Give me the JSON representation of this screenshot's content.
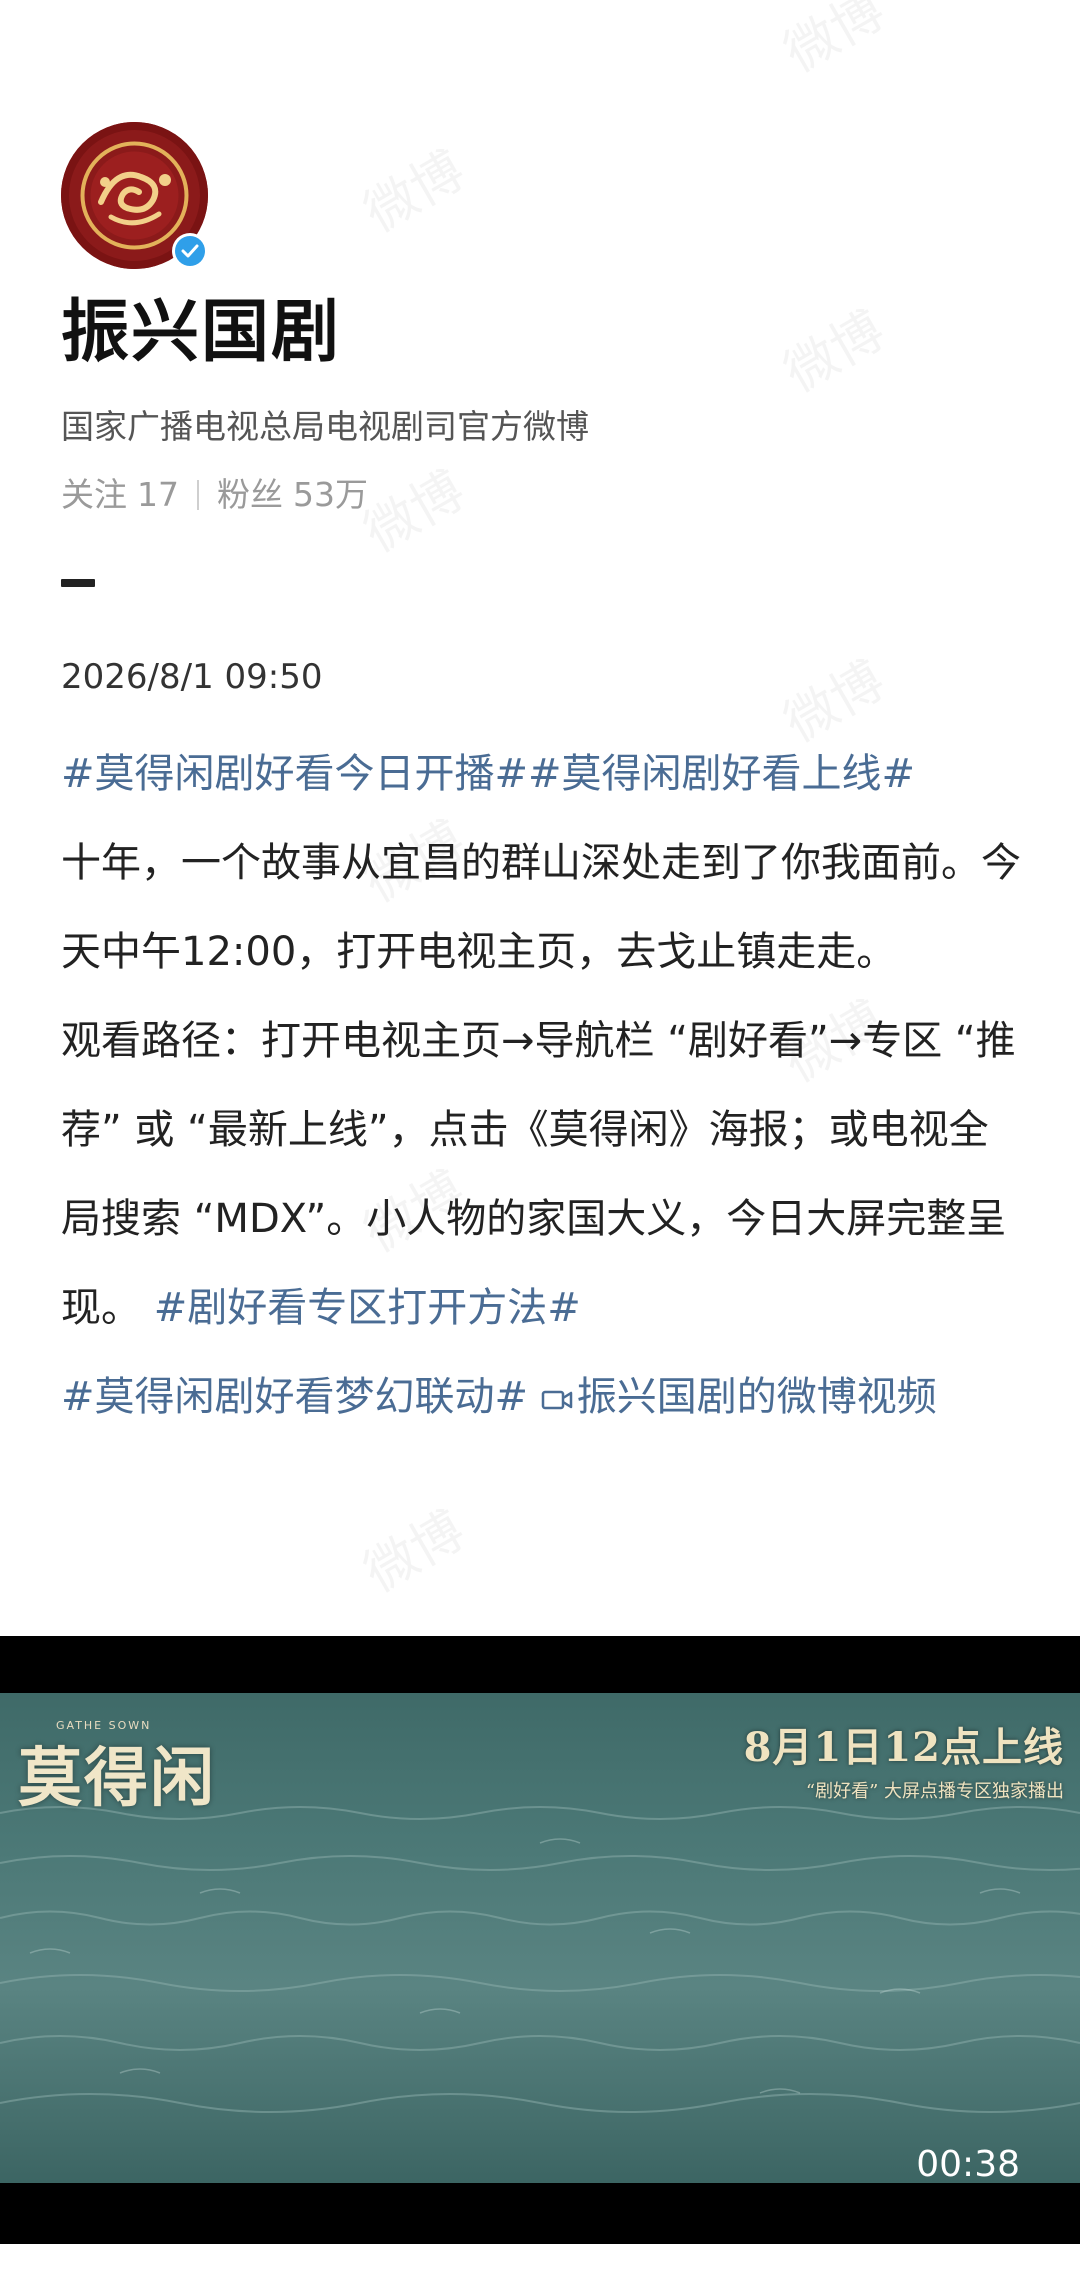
{
  "profile": {
    "name": "振兴国剧",
    "description": "国家广播电视总局电视剧司官方微博",
    "following_label": "关注",
    "following_count": "17",
    "followers_label": "粉丝",
    "followers_count": "53万"
  },
  "watermark": "微博",
  "post": {
    "timestamp": "2026/8/1 09:50",
    "tag1": "#莫得闲剧好看今日开播#",
    "tag2": "#莫得闲剧好看上线#",
    "body1": "十年，一个故事从宜昌的群山深处走到了你我面前。今天中午12:00，打开电视主页，去戈止镇走走。",
    "body2": "观看路径：打开电视主页→导航栏 “剧好看”→专区 “推荐” 或 “最新上线”，点击《莫得闲》海报；或电视全局搜索 “MDX”。小人物的家国大义，今日大屏完整呈现。",
    "tag3": "#剧好看专区打开方法#",
    "tag4": "#莫得闲剧好看梦幻联动#",
    "video_link": "振兴国剧的微博视频"
  },
  "video": {
    "logo_title": "莫得闲",
    "logo_subtitle": "GATHE SOWN",
    "release_line1": "8月1日12点上线",
    "release_line2": "“剧好看” 大屏点播专区独家播出",
    "duration": "00:38"
  },
  "colors": {
    "link": "#4a6c94",
    "verified": "#2f9fe9",
    "avatar": "#8b1a1a"
  },
  "icons": [
    "verified-badge-icon",
    "video-camera-icon"
  ]
}
